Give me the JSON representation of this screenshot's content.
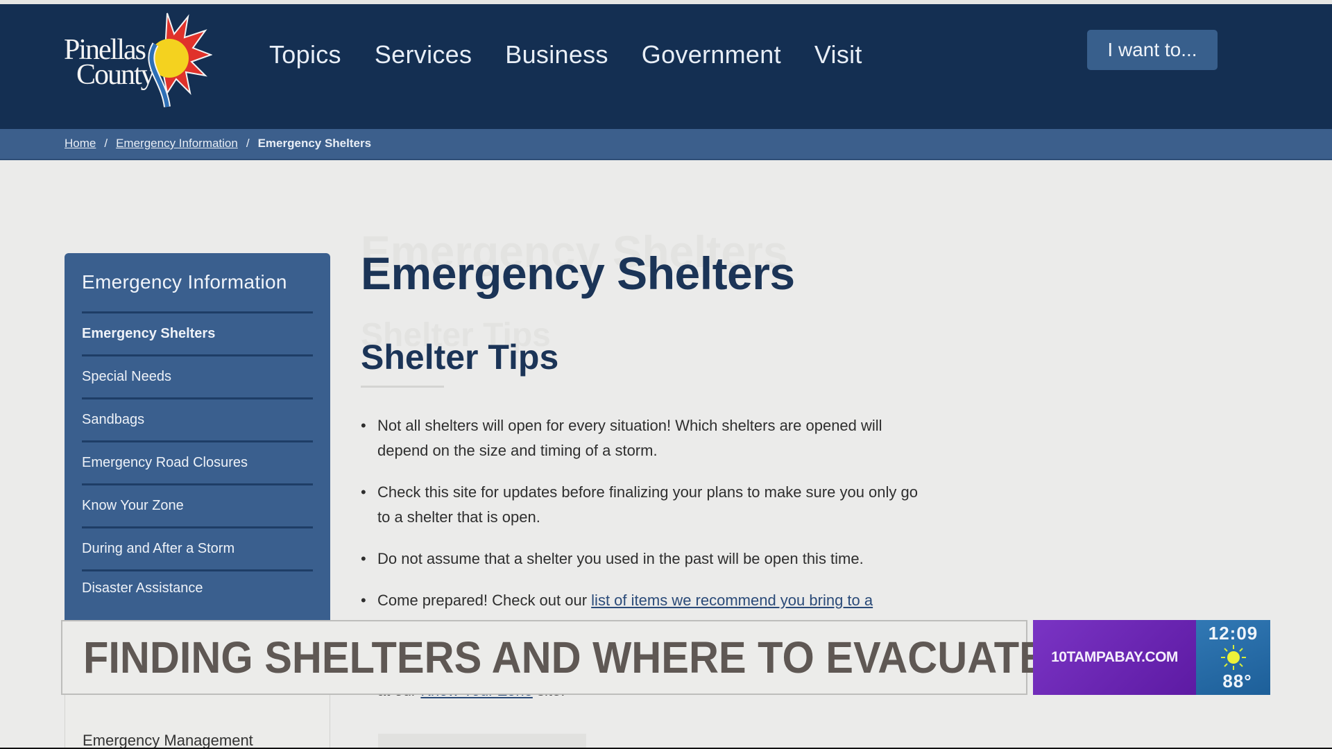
{
  "header": {
    "logo_line1": "Pinellas",
    "logo_line2": "County",
    "nav": [
      "Topics",
      "Services",
      "Business",
      "Government",
      "Visit"
    ],
    "cta_label": "I want to..."
  },
  "breadcrumb": {
    "items": [
      "Home",
      "Emergency Information"
    ],
    "current": "Emergency Shelters",
    "separator": "/"
  },
  "sidebar": {
    "title": "Emergency Information",
    "items": [
      {
        "label": "Emergency Shelters",
        "active": true
      },
      {
        "label": "Special Needs"
      },
      {
        "label": "Sandbags"
      },
      {
        "label": "Emergency Road Closures"
      },
      {
        "label": "Know Your Zone"
      },
      {
        "label": "During and After a Storm"
      },
      {
        "label": "Disaster Assistance"
      }
    ],
    "lower_label": "Emergency Management"
  },
  "main": {
    "page_title": "Emergency Shelters",
    "section_title": "Shelter Tips",
    "tips": [
      {
        "text": "Not all shelters will open for every situation! Which shelters are opened will depend on the size and timing of a storm."
      },
      {
        "text": "Check this site for updates before finalizing your plans to make sure you only go to a shelter that is open."
      },
      {
        "text": "Do not assume that a shelter you used in the past will be open this time."
      },
      {
        "text": "Come prepared! Check out our ",
        "link": "list of items we recommend you bring to a"
      }
    ],
    "tail_prefix": "at our ",
    "tail_link": "Know Your Zone",
    "tail_suffix": " site."
  },
  "broadcast": {
    "headline": "FINDING SHELTERS AND WHERE TO EVACUATE",
    "station": "10TAMPABAY.COM",
    "time": "12:09",
    "weather_icon": "sun-icon",
    "temperature": "88°",
    "colors": {
      "station_bg": "#6a27b5",
      "weather_bg": "#2568a6",
      "headline_text": "#5f5854"
    }
  },
  "colors": {
    "header_bg": "#142f52",
    "breadcrumb_bg": "#3c5f8c",
    "sidebar_bg": "#3a5f8e",
    "title_text": "#1b3457"
  }
}
